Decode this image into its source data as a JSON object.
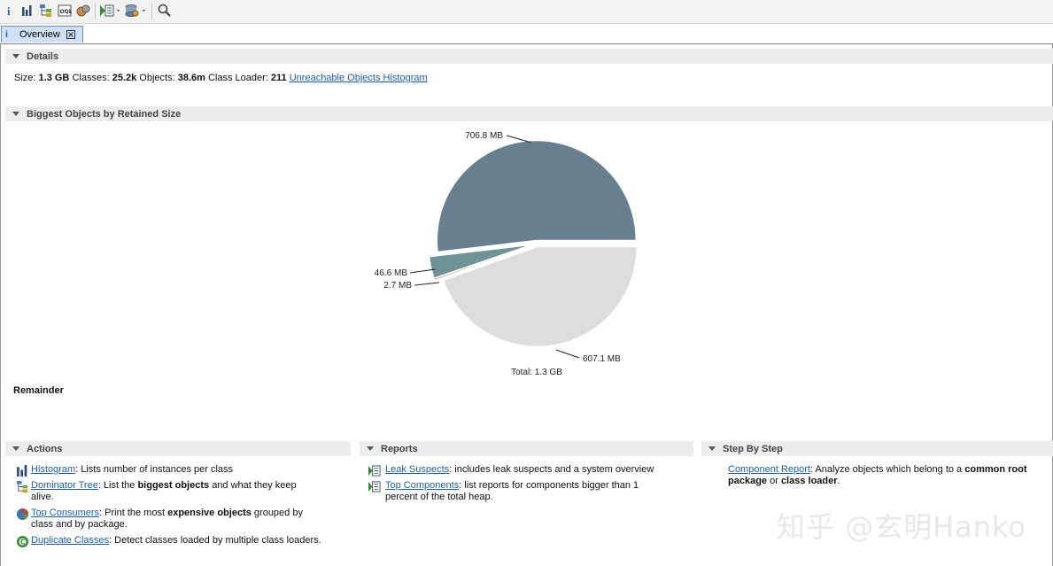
{
  "toolbar": {
    "icons": [
      "info-icon",
      "histogram-icon",
      "dominator-tree-icon",
      "oql-icon",
      "thread-overview-icon",
      "run-report-icon",
      "query-browser-icon",
      "search-icon"
    ]
  },
  "tab": {
    "icon": "i",
    "label": "Overview"
  },
  "details": {
    "header": "Details",
    "size_label": "Size:",
    "size_value": "1.3 GB",
    "classes_label": "Classes:",
    "classes_value": "25.2k",
    "objects_label": "Objects:",
    "objects_value": "38.6m",
    "classloader_label": "Class Loader:",
    "classloader_value": "211",
    "histogram_link": "Unreachable Objects Histogram"
  },
  "biggest": {
    "header": "Biggest Objects by Retained Size",
    "remainder_label": "Remainder"
  },
  "chart_data": {
    "type": "pie",
    "categories": [
      "706.8 MB",
      "46.6 MB",
      "2.7 MB",
      "607.1 MB"
    ],
    "values": [
      706.8,
      46.6,
      2.7,
      607.1
    ],
    "colors": [
      "#687f8f",
      "#6f9394",
      "#a8b484",
      "#dddddd"
    ],
    "total_label": "Total: 1.3 GB"
  },
  "actions": {
    "header": "Actions",
    "items": [
      {
        "link": "Histogram",
        "text": ": Lists number of instances per class"
      },
      {
        "link": "Dominator Tree",
        "text": ": List the ",
        "bold": "biggest objects",
        "text2": " and what they keep",
        "line2": "alive."
      },
      {
        "link": "Top Consumers",
        "text": ": Print the most ",
        "bold": "expensive objects",
        "text2": " grouped by",
        "line2": "class and by package."
      },
      {
        "link": "Duplicate Classes",
        "text": ": Detect classes loaded by multiple class loaders."
      }
    ]
  },
  "reports": {
    "header": "Reports",
    "items": [
      {
        "link": "Leak Suspects",
        "text": ": includes leak suspects and a system overview"
      },
      {
        "link": "Top Components",
        "text": ": list reports for components bigger than 1",
        "line2": "percent of the total heap."
      }
    ]
  },
  "stepbystep": {
    "header": "Step By Step",
    "items": [
      {
        "link": "Component Report",
        "text": ": Analyze objects which belong to a ",
        "bold": "common root",
        "line2_bold": "package",
        "line2_text": " or ",
        "line2_bold2": "class loader",
        "line2_end": "."
      }
    ]
  },
  "watermark": "知乎 @玄明Hanko",
  "colors": {
    "link": "#1a5fb4",
    "header_bg": "#ededed",
    "tab_bg": "#cfe0f7"
  }
}
